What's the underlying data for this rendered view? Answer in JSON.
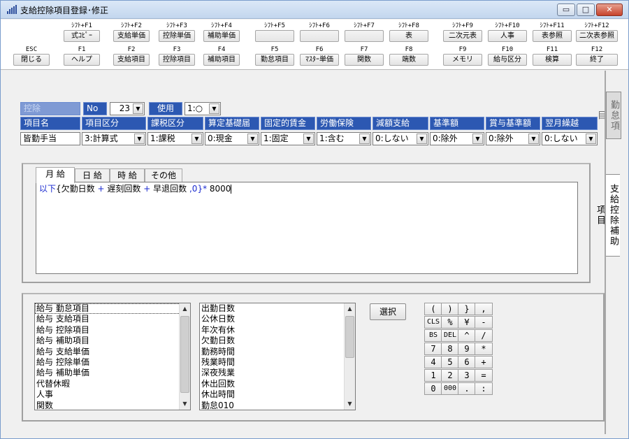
{
  "window": {
    "title": "支給控除項目登録･修正",
    "controls": {
      "minimize": "▭",
      "maximize": "□",
      "close": "✕"
    }
  },
  "fkeys": [
    {
      "sub": "ESC",
      "label": "閉じる"
    },
    {
      "sub": "ｼﾌﾄ+F1",
      "label": "式ｺﾋﾟｰ",
      "sub2": "F1",
      "label2": "ヘルプ"
    },
    {
      "sub": "ｼﾌﾄ+F2",
      "label": "支給単価",
      "sub2": "F2",
      "label2": "支給項目"
    },
    {
      "sub": "ｼﾌﾄ+F3",
      "label": "控除単価",
      "sub2": "F3",
      "label2": "控除項目"
    },
    {
      "sub": "ｼﾌﾄ+F4",
      "label": "補助単価",
      "sub2": "F4",
      "label2": "補助項目"
    },
    {
      "sub": "ｼﾌﾄ+F5",
      "label": "",
      "sub2": "F5",
      "label2": "勤怠項目"
    },
    {
      "sub": "ｼﾌﾄ+F6",
      "label": "",
      "sub2": "F6",
      "label2": "ﾏｽﾀｰ単価"
    },
    {
      "sub": "ｼﾌﾄ+F7",
      "label": "",
      "sub2": "F7",
      "label2": "関数"
    },
    {
      "sub": "ｼﾌﾄ+F8",
      "label": "表",
      "sub2": "F8",
      "label2": "端数"
    },
    {
      "sub": "ｼﾌﾄ+F9",
      "label": "二次元表",
      "sub2": "F9",
      "label2": "メモリ"
    },
    {
      "sub": "ｼﾌﾄ+F10",
      "label": "人事",
      "sub2": "F10",
      "label2": "給与区分"
    },
    {
      "sub": "ｼﾌﾄ+F11",
      "label": "表参照",
      "sub2": "F11",
      "label2": "検算"
    },
    {
      "sub": "ｼﾌﾄ+F12",
      "label": "二次表参照",
      "sub2": "F12",
      "label2": "終了"
    }
  ],
  "side_tabs": {
    "inactive": "勤怠項目",
    "active": "支給控除補助項目"
  },
  "top_fields": {
    "category_label": "控除",
    "no_label": "No",
    "no_value": "23",
    "use_label": "使用",
    "use_value": "1:○"
  },
  "columns": [
    {
      "header": "項目名",
      "value": "皆勤手当",
      "type": "text"
    },
    {
      "header": "項目区分",
      "value": "3:計算式",
      "type": "select"
    },
    {
      "header": "課税区分",
      "value": "1:課税",
      "type": "select"
    },
    {
      "header": "算定基礎届",
      "value": "0:現金",
      "type": "select"
    },
    {
      "header": "固定的賃金",
      "value": "1:固定",
      "type": "select"
    },
    {
      "header": "労働保険",
      "value": "1:含む",
      "type": "select"
    },
    {
      "header": "減額支給",
      "value": "0:しない",
      "type": "select"
    },
    {
      "header": "基準額",
      "value": "0:除外",
      "type": "select"
    },
    {
      "header": "賞与基準額",
      "value": "0:除外",
      "type": "select"
    },
    {
      "header": "翌月繰越",
      "value": "0:しない",
      "type": "select"
    }
  ],
  "tabs": [
    "月 給",
    "日 給",
    "時 給",
    "その他"
  ],
  "formula": {
    "kw1": "以下",
    "brace_open": "{",
    "term1": "欠勤日数",
    "op1": "+",
    "term2": "遅刻回数",
    "op2": "+",
    "term3": "早退回数",
    "sep": ",",
    "zero": "0",
    "brace_close": "}",
    "mult": "*",
    "number": "8000"
  },
  "category_list": [
    "給与 勤怠項目",
    "給与 支給項目",
    "給与 控除項目",
    "給与 補助項目",
    "給与 支給単価",
    "給与 控除単価",
    "給与 補助単価",
    "代替休暇",
    "人事",
    "関数"
  ],
  "item_list": [
    "出勤日数",
    "公休日数",
    "年次有休",
    "欠勤日数",
    "勤務時間",
    "残業時間",
    "深夜残業",
    "休出回数",
    "休出時間",
    "勤怠010"
  ],
  "select_button": "選択",
  "keypad": [
    [
      "(",
      ")",
      "}",
      ","
    ],
    [
      "CLS",
      "%",
      "¥",
      "-"
    ],
    [
      "BS",
      "DEL",
      "^",
      "/"
    ],
    [
      "7",
      "8",
      "9",
      "*"
    ],
    [
      "4",
      "5",
      "6",
      "+"
    ],
    [
      "1",
      "2",
      "3",
      "="
    ],
    [
      "0",
      "000",
      ".",
      ":"
    ]
  ]
}
